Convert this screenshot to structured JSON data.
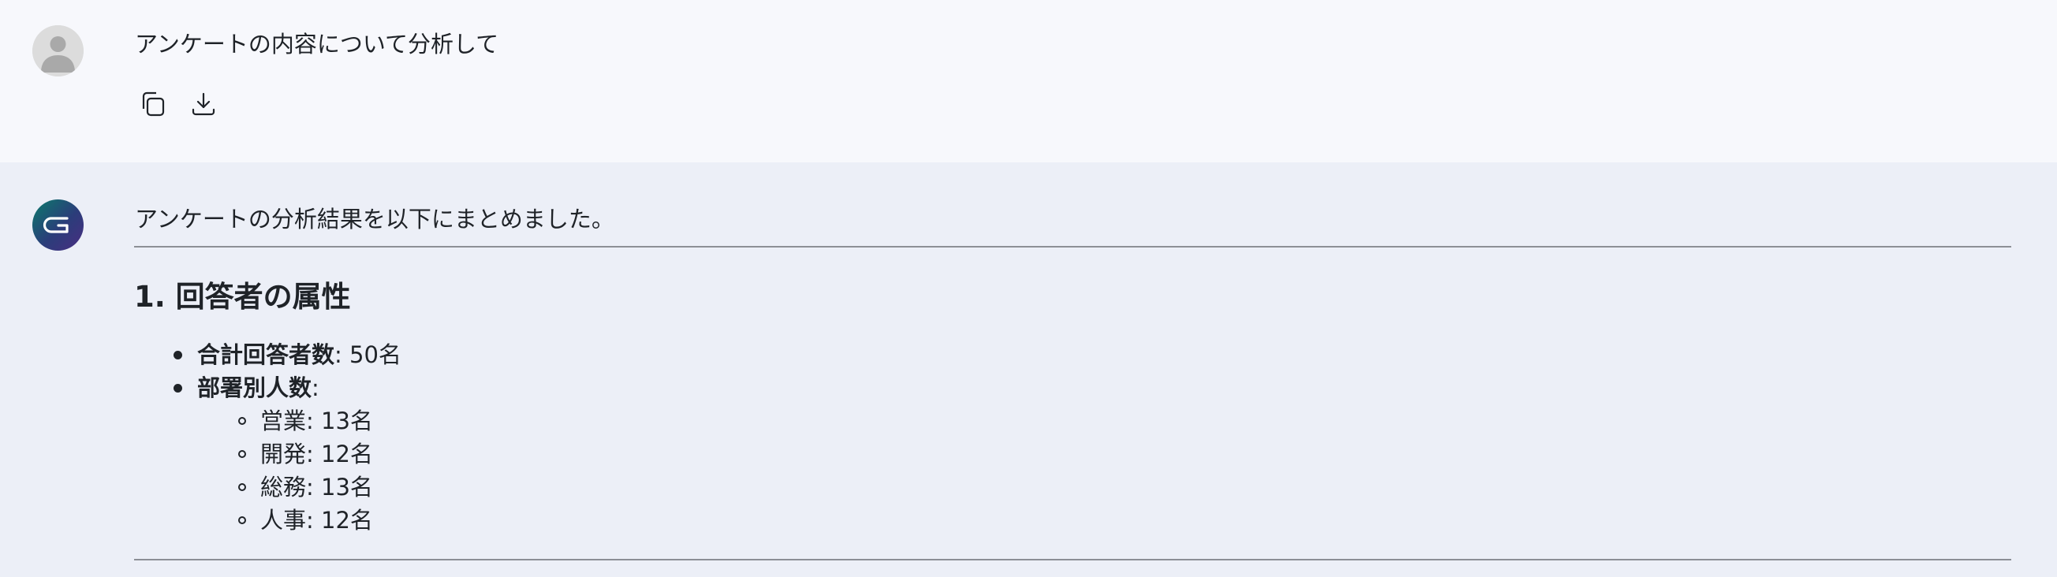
{
  "user_message": {
    "text": "アンケートの内容について分析して",
    "actions": [
      {
        "name": "copy",
        "icon": "copy-icon"
      },
      {
        "name": "download",
        "icon": "download-icon"
      }
    ]
  },
  "assistant_message": {
    "intro": "アンケートの分析結果を以下にまとめました。",
    "section_heading": "1. 回答者の属性",
    "items": [
      {
        "label": "合計回答者数",
        "separator": ": ",
        "value": "50名"
      },
      {
        "label": "部署別人数",
        "separator": ":",
        "value": ""
      }
    ],
    "departments": [
      {
        "text": "営業: 13名"
      },
      {
        "text": "開発: 12名"
      },
      {
        "text": "総務: 13名"
      },
      {
        "text": "人事: 12名"
      }
    ]
  },
  "colors": {
    "user_bg": "#f7f8fc",
    "assistant_bg": "#eceff7",
    "text": "#1f2328",
    "divider": "#8c8f96"
  }
}
